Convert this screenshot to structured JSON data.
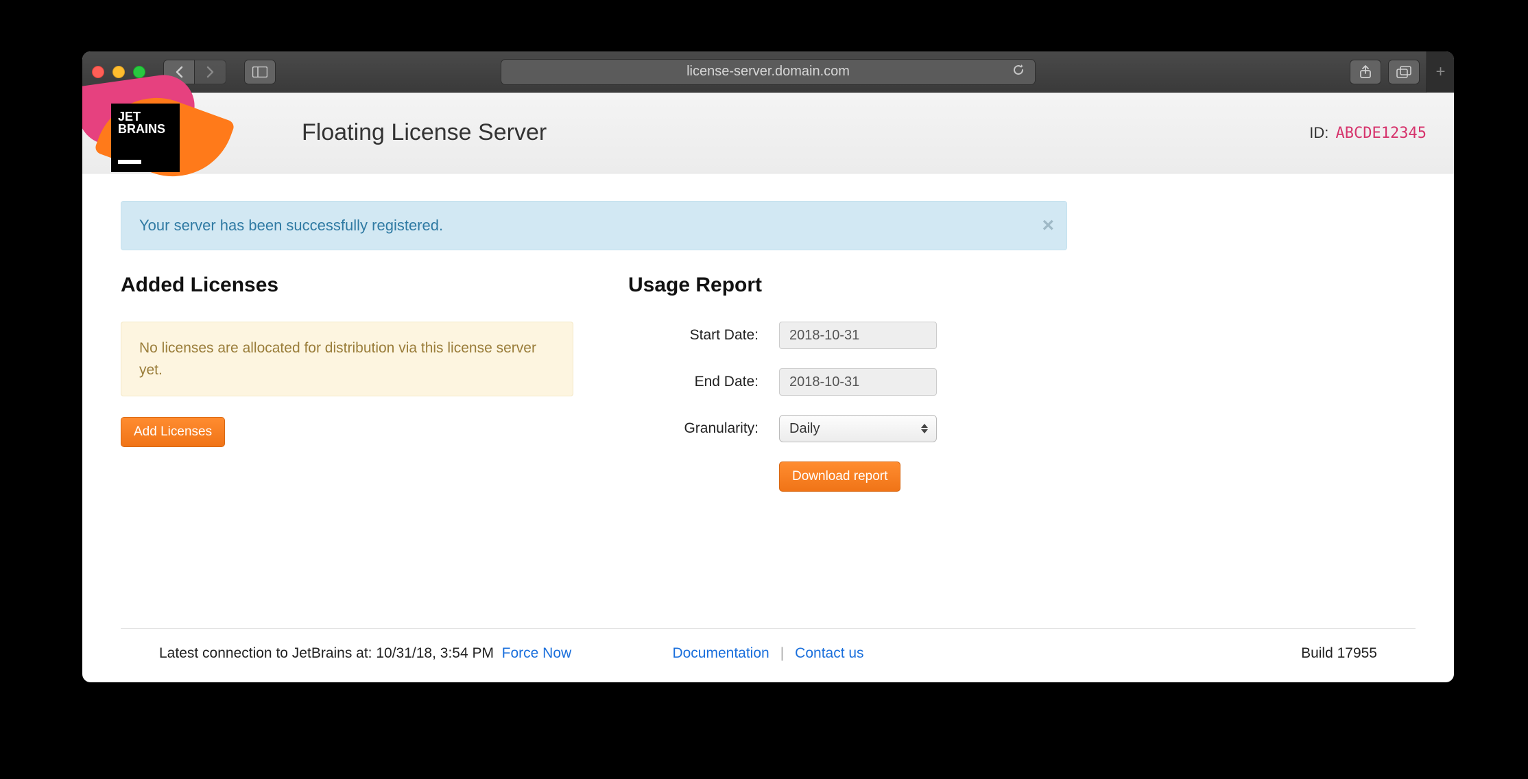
{
  "browser": {
    "url": "license-server.domain.com"
  },
  "header": {
    "logo_line1": "JET",
    "logo_line2": "BRAINS",
    "title": "Floating License Server",
    "id_label": "ID:",
    "id_value": "ABCDE12345"
  },
  "alerts": {
    "success": "Your server has been successfully registered."
  },
  "licenses": {
    "heading": "Added Licenses",
    "empty_text": "No licenses are allocated for distribution via this license server yet.",
    "add_button": "Add Licenses"
  },
  "usage": {
    "heading": "Usage Report",
    "start_label": "Start Date:",
    "start_value": "2018-10-31",
    "end_label": "End Date:",
    "end_value": "2018-10-31",
    "granularity_label": "Granularity:",
    "granularity_value": "Daily",
    "download_button": "Download report"
  },
  "footer": {
    "connection_prefix": "Latest connection to JetBrains at: ",
    "connection_time": "10/31/18, 3:54 PM",
    "force_now": "Force Now",
    "documentation": "Documentation",
    "contact": "Contact us",
    "build_label": "Build ",
    "build_value": "17955"
  }
}
